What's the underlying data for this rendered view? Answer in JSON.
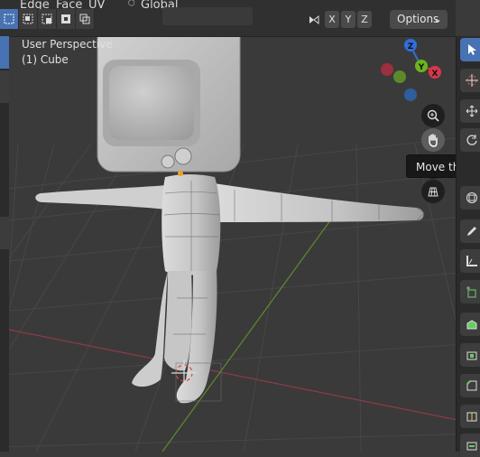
{
  "header": {
    "menu_items": [
      "Edge",
      "Face",
      "UV"
    ],
    "transform_orientation": "Global",
    "axis_toggles": [
      "X",
      "Y",
      "Z"
    ],
    "options_label": "Options"
  },
  "viewport": {
    "perspective_label": "User Perspective",
    "object_label": "(1) Cube"
  },
  "gizmo": {
    "axes": [
      {
        "label": "Z",
        "color": "#2f6fd8"
      },
      {
        "label": "Y",
        "color": "#6ab51a"
      },
      {
        "label": "X",
        "color": "#d9374a"
      }
    ],
    "negative_colors": {
      "x": "#9b3040",
      "y": "#5c8a2a",
      "z": "#305d9c"
    }
  },
  "navigation": {
    "buttons": [
      "zoom-icon",
      "hand-icon",
      "camera-icon",
      "grid-icon"
    ],
    "tooltip": "Move the view"
  },
  "colors": {
    "background": "#3a3a3a",
    "grid": "#4a4a4a",
    "x_axis_line": "#8e3a45",
    "y_axis_line": "#5f8a2e",
    "model": "#c8c8c8",
    "selection_blue": "#4772b3"
  }
}
